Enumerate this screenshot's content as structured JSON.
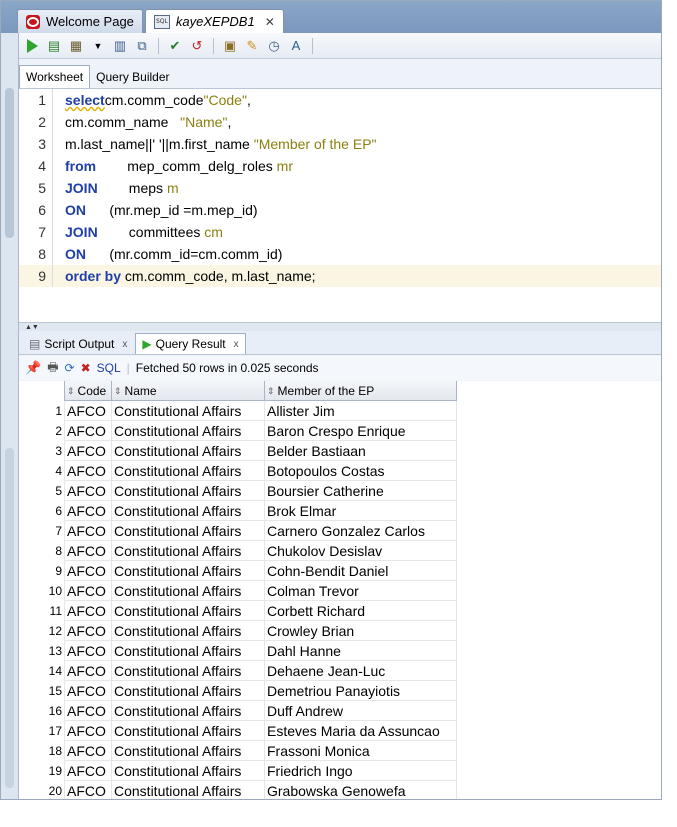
{
  "doc_tabs": [
    {
      "label": "Welcome Page"
    },
    {
      "label": "kayeXEPDB1"
    }
  ],
  "worksheet_tabs": [
    {
      "label": "Worksheet"
    },
    {
      "label": "Query Builder"
    }
  ],
  "editor": {
    "line_numbers": [
      "1",
      "2",
      "3",
      "4",
      "5",
      "6",
      "7",
      "8",
      "9"
    ],
    "lines": [
      [
        [
          "kw",
          "select"
        ],
        [
          "",
          "cm.comm_code"
        ],
        [
          "str",
          "\"Code\""
        ],
        [
          "",
          ","
        ]
      ],
      [
        [
          "",
          "cm.comm_name   "
        ],
        [
          "str",
          "\"Name\""
        ],
        [
          "",
          ","
        ]
      ],
      [
        [
          "",
          "m.last_name||' '||m.first_name "
        ],
        [
          "str",
          "\"Member of the EP\""
        ]
      ],
      [
        [
          "kw",
          "from"
        ],
        [
          "",
          "        mep_comm_delg_roles "
        ],
        [
          "al",
          "mr"
        ]
      ],
      [
        [
          "kw",
          "JOIN"
        ],
        [
          "",
          "        meps "
        ],
        [
          "al",
          "m"
        ]
      ],
      [
        [
          "kw",
          "ON"
        ],
        [
          "",
          "      (mr.mep_id =m.mep_id)"
        ]
      ],
      [
        [
          "kw",
          "JOIN"
        ],
        [
          "",
          "        committees "
        ],
        [
          "al",
          "cm"
        ]
      ],
      [
        [
          "kw",
          "ON"
        ],
        [
          "",
          "      (mr.comm_id=cm.comm_id)"
        ]
      ],
      [
        [
          "kw",
          "order by"
        ],
        [
          "",
          " cm.comm_code, m.last_name;"
        ]
      ]
    ]
  },
  "result_tabs": [
    {
      "label": "Script Output",
      "close": "x"
    },
    {
      "label": "Query Result",
      "close": "x"
    }
  ],
  "result_toolbar": {
    "sql_label": "SQL",
    "status": "Fetched 50 rows in 0.025 seconds"
  },
  "grid": {
    "columns": [
      "Code",
      "Name",
      "Member of the EP"
    ],
    "rows": [
      [
        "1",
        "AFCO",
        "Constitutional Affairs",
        "Allister Jim"
      ],
      [
        "2",
        "AFCO",
        "Constitutional Affairs",
        "Baron Crespo Enrique"
      ],
      [
        "3",
        "AFCO",
        "Constitutional Affairs",
        "Belder Bastiaan"
      ],
      [
        "4",
        "AFCO",
        "Constitutional Affairs",
        "Botopoulos Costas"
      ],
      [
        "5",
        "AFCO",
        "Constitutional Affairs",
        "Boursier Catherine"
      ],
      [
        "6",
        "AFCO",
        "Constitutional Affairs",
        "Brok Elmar"
      ],
      [
        "7",
        "AFCO",
        "Constitutional Affairs",
        "Carnero Gonzalez Carlos"
      ],
      [
        "8",
        "AFCO",
        "Constitutional Affairs",
        "Chukolov Desislav"
      ],
      [
        "9",
        "AFCO",
        "Constitutional Affairs",
        "Cohn-Bendit Daniel"
      ],
      [
        "10",
        "AFCO",
        "Constitutional Affairs",
        "Colman Trevor"
      ],
      [
        "11",
        "AFCO",
        "Constitutional Affairs",
        "Corbett Richard"
      ],
      [
        "12",
        "AFCO",
        "Constitutional Affairs",
        "Crowley Brian"
      ],
      [
        "13",
        "AFCO",
        "Constitutional Affairs",
        "Dahl Hanne"
      ],
      [
        "14",
        "AFCO",
        "Constitutional Affairs",
        "Dehaene Jean-Luc"
      ],
      [
        "15",
        "AFCO",
        "Constitutional Affairs",
        "Demetriou Panayiotis"
      ],
      [
        "16",
        "AFCO",
        "Constitutional Affairs",
        "Duff Andrew"
      ],
      [
        "17",
        "AFCO",
        "Constitutional Affairs",
        "Esteves Maria da Assuncao"
      ],
      [
        "18",
        "AFCO",
        "Constitutional Affairs",
        "Frassoni Monica"
      ],
      [
        "19",
        "AFCO",
        "Constitutional Affairs",
        "Friedrich Ingo"
      ],
      [
        "20",
        "AFCO",
        "Constitutional Affairs",
        "Grabowska Genowefa"
      ]
    ]
  }
}
